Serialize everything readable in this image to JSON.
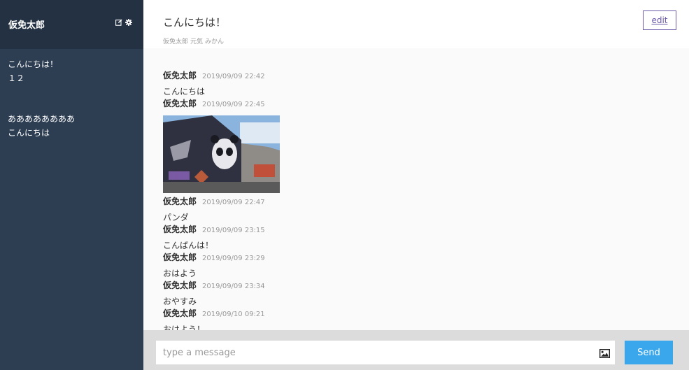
{
  "sidebar": {
    "user_name": "仮免太郎",
    "groups": [
      {
        "name": "こんにちは！",
        "last_message": "１２"
      },
      {
        "name": "ああああああああ",
        "last_message": "こんにちは"
      }
    ]
  },
  "main": {
    "group_title": "こんにちは！",
    "members": [
      "仮免太郎",
      "元気",
      "みかん"
    ],
    "edit_label": "edit",
    "messages": [
      {
        "user": "仮免太郎",
        "date": "2019/09/09 22:42",
        "text": "こんにちは"
      },
      {
        "user": "仮免太郎",
        "date": "2019/09/09 22:45",
        "text": "",
        "image": "photo of panda mural on building"
      },
      {
        "user": "仮免太郎",
        "date": "2019/09/09 22:47",
        "text": "パンダ"
      },
      {
        "user": "仮免太郎",
        "date": "2019/09/09 23:15",
        "text": "こんばんは！"
      },
      {
        "user": "仮免太郎",
        "date": "2019/09/09 23:29",
        "text": "おはよう"
      },
      {
        "user": "仮免太郎",
        "date": "2019/09/09 23:34",
        "text": "おやすみ"
      },
      {
        "user": "仮免太郎",
        "date": "2019/09/10 09:21",
        "text": "おはよう！"
      }
    ]
  },
  "form": {
    "placeholder": "type a message",
    "image_icon": "image-icon",
    "send_label": "Send"
  },
  "colors": {
    "sidebar_bg": "#2d3d52",
    "sidebar_header_bg": "#243142",
    "send_button": "#3aa6ec",
    "edit_border": "#6b5aa8"
  }
}
